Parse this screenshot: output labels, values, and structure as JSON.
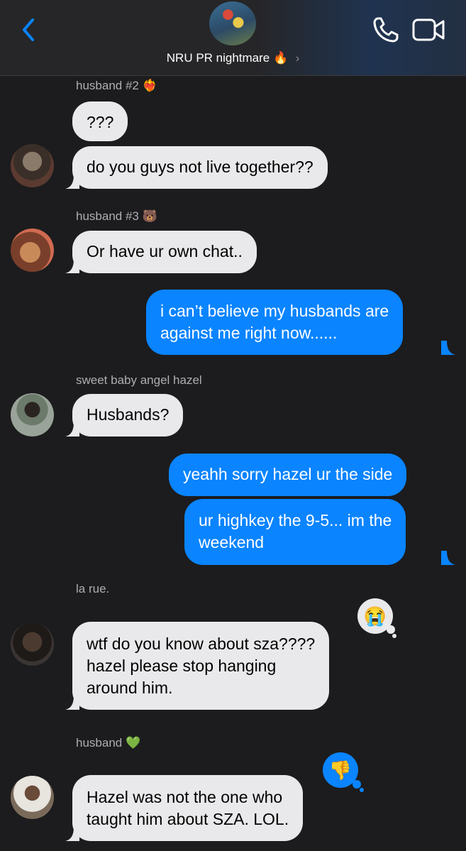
{
  "header": {
    "group_name": "NRU PR nightmare",
    "group_emoji": "🔥",
    "chevron": "›"
  },
  "colors": {
    "background": "#1c1c1e",
    "incoming_bubble": "#e9e9eb",
    "outgoing_bubble": "#0a84ff",
    "accent": "#0a84ff"
  },
  "icons": {
    "back": "chevron-left-icon",
    "call": "phone-icon",
    "video": "video-camera-icon"
  },
  "messages": [
    {
      "sender": "husband #2",
      "sender_emoji": "❤️‍🔥",
      "text": "???"
    },
    {
      "text": "do you guys not live together??"
    },
    {
      "sender": "husband #3",
      "sender_emoji": "🐻",
      "text": "Or have ur own chat.."
    },
    {
      "text_lines": [
        "i can’t believe my husbands are",
        "against me right now......"
      ]
    },
    {
      "sender": "sweet baby angel hazel",
      "text": "Husbands?"
    },
    {
      "text": "yeahh sorry hazel ur the side"
    },
    {
      "text_lines": [
        "ur highkey the 9-5... im the",
        "weekend"
      ]
    },
    {
      "sender": "la rue.",
      "reaction": "😭",
      "text_lines": [
        "wtf do you know about sza????",
        "hazel please stop hanging",
        "around him."
      ]
    },
    {
      "sender": "husband",
      "sender_emoji": "💚",
      "reaction": "👎",
      "text_lines": [
        "Hazel was not the one who",
        "taught him about SZA. LOL."
      ]
    }
  ]
}
